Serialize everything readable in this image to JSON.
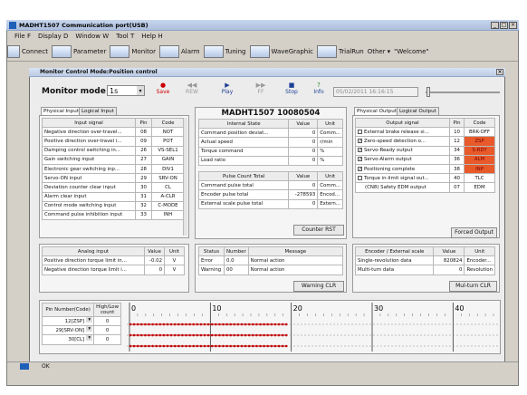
{
  "window": {
    "title": "MADHT1507 Communication port(USB)"
  },
  "menu": [
    "File F",
    "Display D",
    "Window W",
    "Tool T",
    "Help H"
  ],
  "toolbar": [
    "Connect",
    "Parameter",
    "Monitor",
    "Alarm",
    "Tuning",
    "WaveGraphic",
    "TrialRun",
    "Other",
    "\"Welcome\""
  ],
  "monitor": {
    "title": "Monitor Control Mode:Position control",
    "mode_label": "Monitor mode",
    "mode_value": "1s",
    "buttons": [
      "Save",
      "REW",
      "Play",
      "FF",
      "Stop",
      "Info"
    ],
    "datetime": "05/02/2011 16:16:15",
    "device": "MADHT1507     10080504"
  },
  "input_tabs": [
    "Physical Input",
    "Logical Input"
  ],
  "input_signal": {
    "headers": [
      "Input signal",
      "Pin",
      "Code"
    ],
    "rows": [
      [
        "Negative direction over-travel...",
        "08",
        "NOT"
      ],
      [
        "Positive direction over-travel i...",
        "09",
        "POT"
      ],
      [
        "Damping control switching in...",
        "26",
        "VS-SEL1"
      ],
      [
        "Gain switching input",
        "27",
        "GAIN"
      ],
      [
        "Electronic gear switching inp...",
        "28",
        "DIV1"
      ],
      [
        "Servo-ON input",
        "29",
        "SRV-ON"
      ],
      [
        "Deviation counter clear input",
        "30",
        "CL"
      ],
      [
        "Alarm clear input",
        "31",
        "A-CLR"
      ],
      [
        "Control mode switching input",
        "32",
        "C-MODE"
      ],
      [
        "Command pulse inhibition input",
        "33",
        "INH"
      ]
    ]
  },
  "internal_state": {
    "headers": [
      "Internal State",
      "Value",
      "Unit"
    ],
    "rows": [
      [
        "Command position deviat...",
        "0",
        "Comm..."
      ],
      [
        "Actual speed",
        "0",
        "r/min"
      ],
      [
        "Torque command",
        "0",
        "%"
      ],
      [
        "Load ratio",
        "0",
        "%"
      ]
    ]
  },
  "pulse_count": {
    "headers": [
      "Pulse Count Total",
      "Value",
      "Unit"
    ],
    "rows": [
      [
        "Command pulse total",
        "0",
        "Comm..."
      ],
      [
        "Encoder pulse total",
        "-278593",
        "Encod..."
      ],
      [
        "External scale pulse total",
        "0",
        "Extern..."
      ]
    ],
    "button": "Counter RST"
  },
  "output_tabs": [
    "Physical Output",
    "Logical Output"
  ],
  "output_signal": {
    "headers": [
      "Output signal",
      "Pin",
      "Code"
    ],
    "rows": [
      {
        "checked": false,
        "name": "External brake release si...",
        "pin": "10",
        "code": "BRK-OFF",
        "active": false
      },
      {
        "checked": true,
        "name": "Zero-speed detection o...",
        "pin": "12",
        "code": "ZSP",
        "active": true
      },
      {
        "checked": true,
        "name": "Servo-Ready output",
        "pin": "34",
        "code": "S-RDY",
        "active": true
      },
      {
        "checked": true,
        "name": "Servo-Alarm output",
        "pin": "36",
        "code": "ALM",
        "active": true
      },
      {
        "checked": true,
        "name": "Positioning complete",
        "pin": "38",
        "code": "INP",
        "active": true
      },
      {
        "checked": false,
        "name": "Torque in-limit signal out...",
        "pin": "40",
        "code": "TLC",
        "active": false
      },
      {
        "checked": null,
        "name": "(CN8) Safety EDM output",
        "pin": "07",
        "code": "EDM",
        "active": false
      }
    ],
    "button": "Forced Output"
  },
  "analog": {
    "headers": [
      "Analog input",
      "Value",
      "Unit"
    ],
    "rows": [
      [
        "Positive direction torque limit in...",
        "-0.02",
        "V"
      ],
      [
        "Negative direction torque limit i...",
        "0",
        "V"
      ]
    ]
  },
  "status": {
    "headers": [
      "Status",
      "Number",
      "Message"
    ],
    "rows": [
      [
        "Error",
        "0.0",
        "Normal action"
      ],
      [
        "Warning",
        "00",
        "Normal action"
      ]
    ],
    "button": "Warning CLR"
  },
  "encoder": {
    "headers": [
      "Encoder / External scale",
      "Value",
      "Unit"
    ],
    "rows": [
      [
        "Single-revolution data",
        "820824",
        "Encoder..."
      ],
      [
        "Multi-turn data",
        "0",
        "Revolution"
      ]
    ],
    "button": "Mul-turn CLR"
  },
  "pin_panel": {
    "headers": [
      "Pin Number(Code)",
      "High/Low count"
    ],
    "rows": [
      [
        "12[ZSP]",
        "0"
      ],
      [
        "29[SRV-ON]",
        "0"
      ],
      [
        "30[CL]",
        "0"
      ]
    ],
    "ticks": [
      "0",
      "10",
      "20",
      "30",
      "40"
    ]
  },
  "statusbar": {
    "text": "OK"
  },
  "colors": {
    "active": "#e85a2a",
    "bg": "#d4d0c8"
  }
}
